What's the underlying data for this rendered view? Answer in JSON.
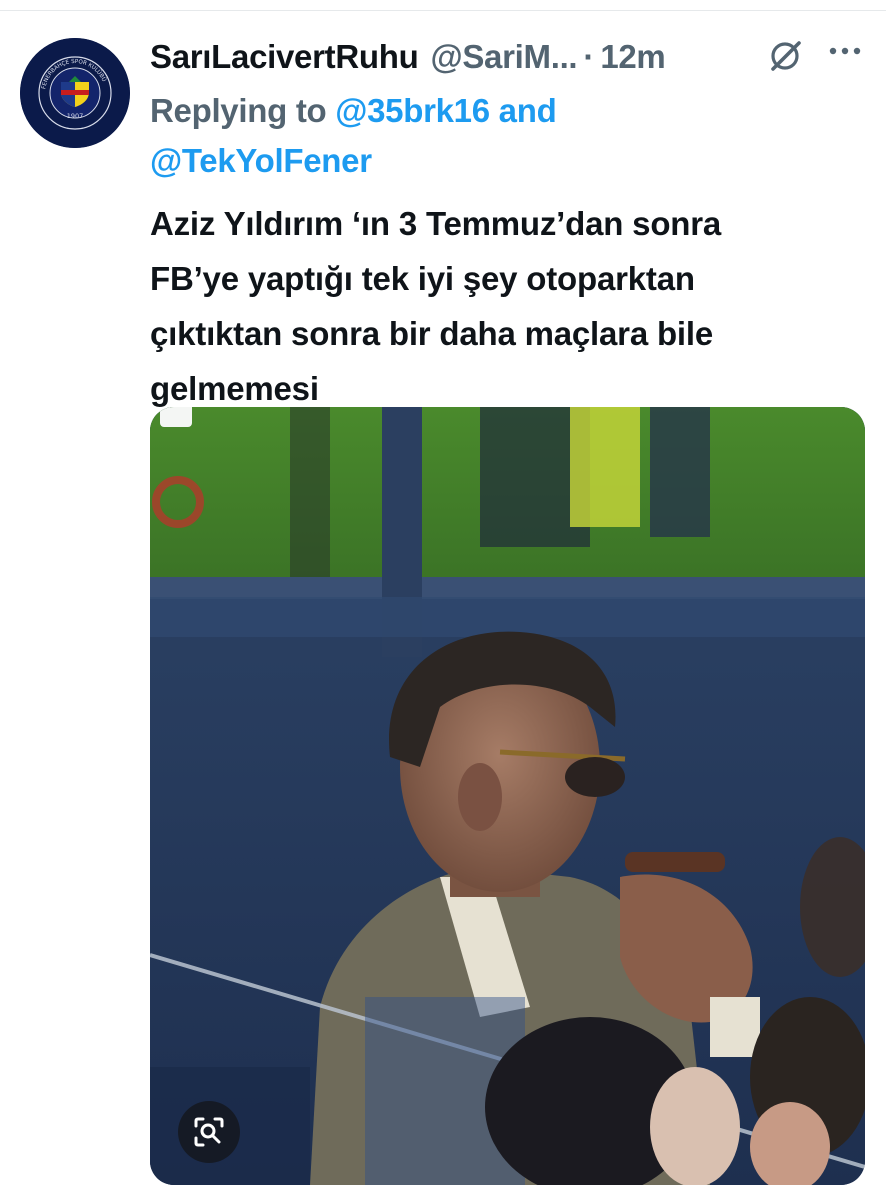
{
  "tweet": {
    "display_name": "SarıLacivertRuhu",
    "handle": "@SariM...",
    "separator": "·",
    "timestamp": "12m",
    "reply": {
      "prefix": "Replying to",
      "mention_1": "@35brk16",
      "joiner": "and",
      "mention_2": "@TekYolFener"
    },
    "text_lines": [
      "Aziz Yıldırım ‘ın 3 Temmuz’dan sonra",
      "FB’ye yaptığı tek iyi şey otoparktan",
      "çıktıktan sonra bir daha maçlara bile",
      "gelmemesi"
    ],
    "avatar_badge": {
      "ring_text": "FENERBAHÇE SPOR KULÜBÜ",
      "year": "1907"
    }
  },
  "icons": {
    "grok": "grok-icon",
    "more": "more-options-icon",
    "lens": "image-search-icon"
  },
  "colors": {
    "primary_text": "#0f1419",
    "secondary_text": "#536471",
    "link": "#1d9bf0",
    "avatar_bg": "#0b1a4a"
  }
}
